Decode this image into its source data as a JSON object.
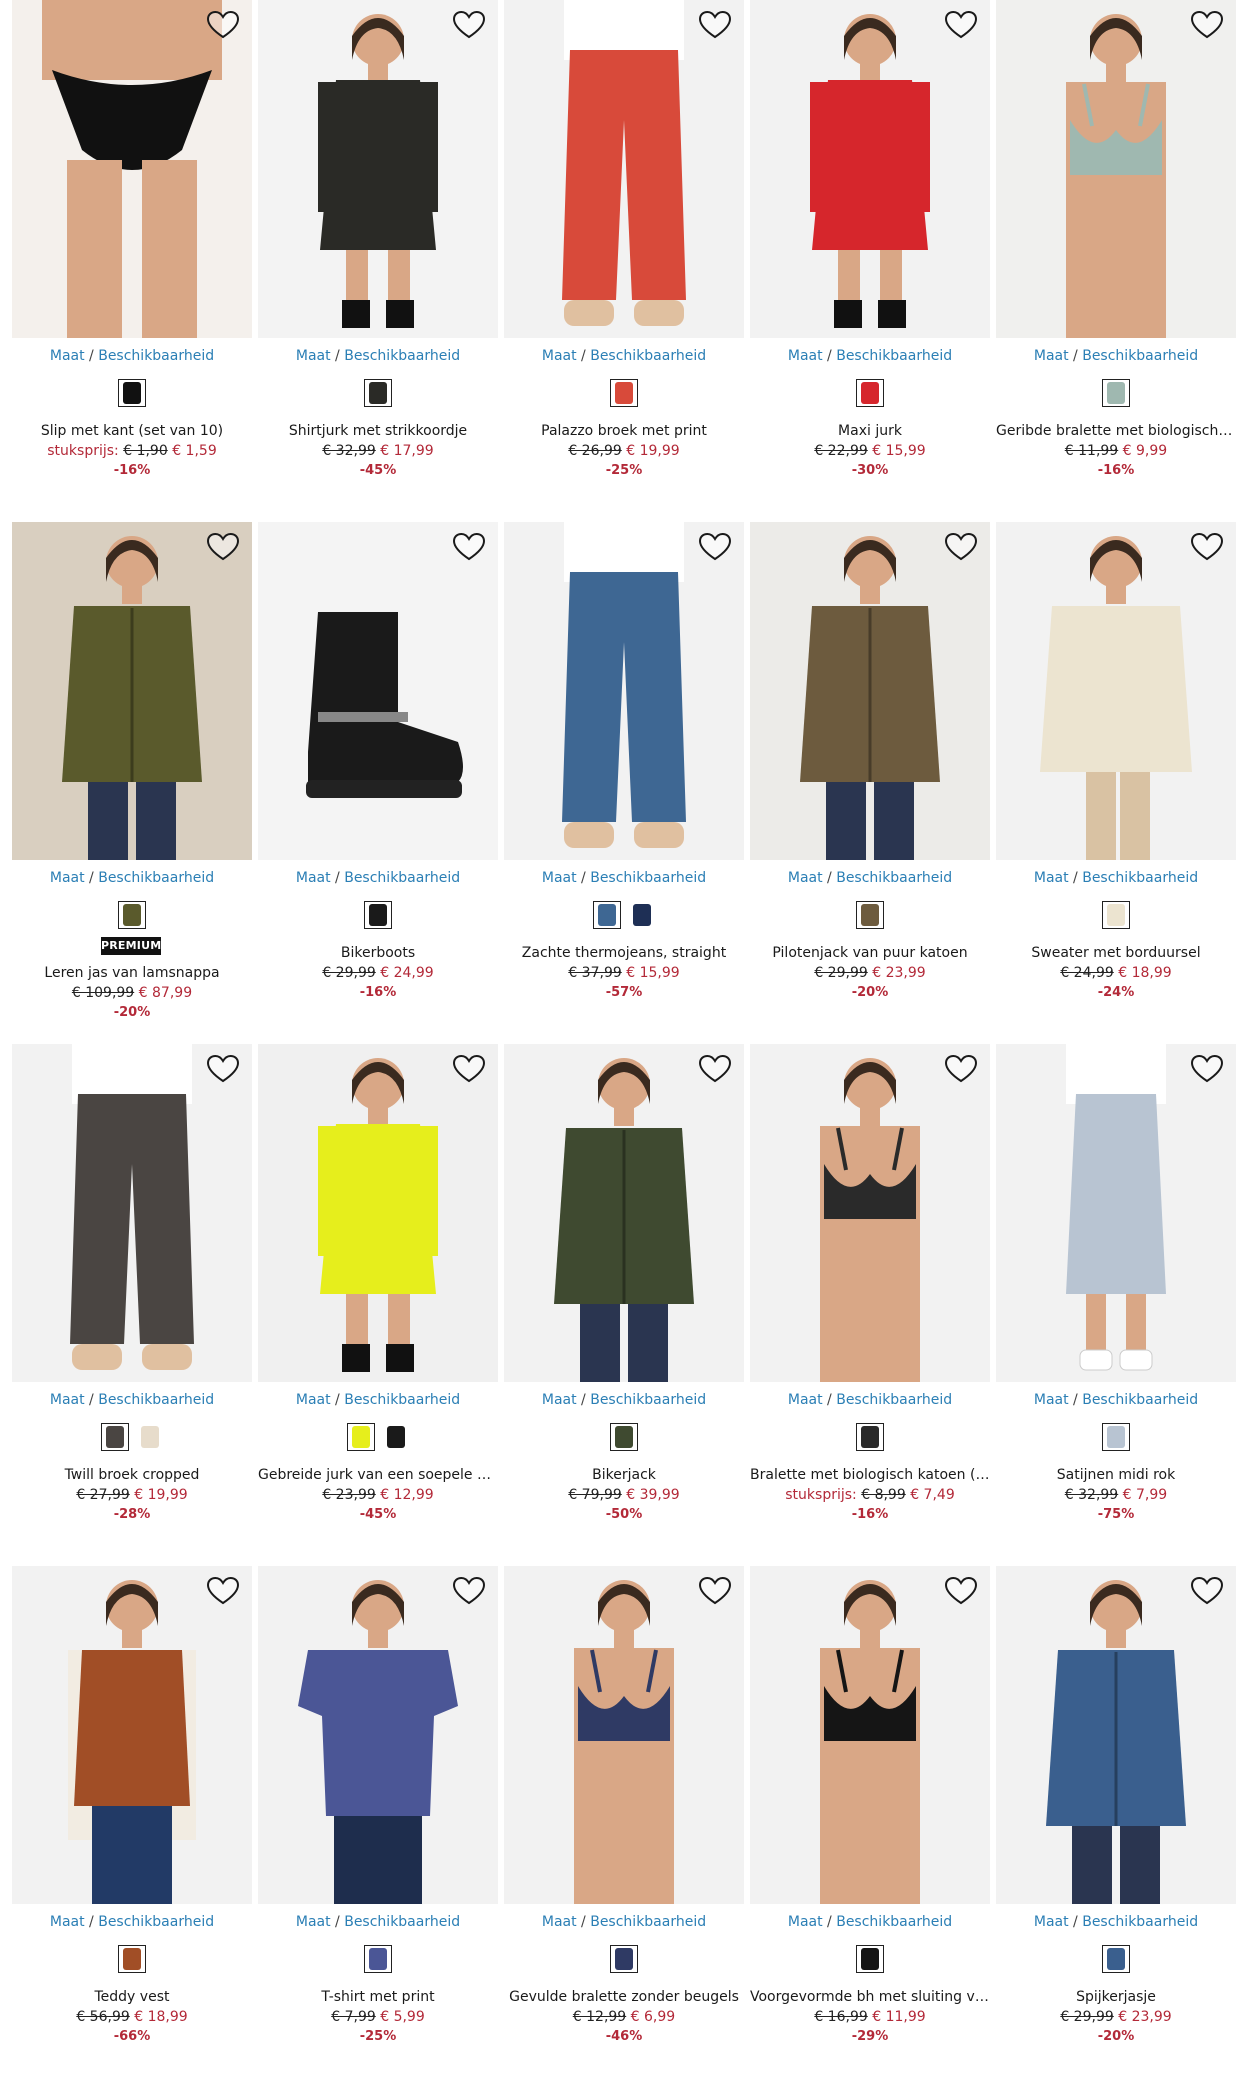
{
  "labels": {
    "size_link": "Maat",
    "separator": "/",
    "availability_link": "Beschikbaarheid"
  },
  "colors": {
    "accent_link": "#2b7fb5",
    "sale_price": "#b32938",
    "text": "#1a1a1a"
  },
  "products": [
    {
      "name": "Slip met kant (set van 10)",
      "unit_label": "stuksprijs:",
      "old_price": "€ 1,90",
      "new_price": "€ 1,59",
      "discount": "-16%",
      "swatches": [
        "#111111"
      ],
      "bg": "#f4f0ec"
    },
    {
      "name": "Shirtjurk met strikkoordje",
      "old_price": "€ 32,99",
      "new_price": "€ 17,99",
      "discount": "-45%",
      "swatches": [
        "#2a2a26"
      ],
      "bg": "#f3f3f3"
    },
    {
      "name": "Palazzo broek met print",
      "old_price": "€ 26,99",
      "new_price": "€ 19,99",
      "discount": "-25%",
      "swatches": [
        "#d84a3a"
      ],
      "bg": "#f2f2f2"
    },
    {
      "name": "Maxi jurk",
      "old_price": "€ 22,99",
      "new_price": "€ 15,99",
      "discount": "-30%",
      "swatches": [
        "#d6262c"
      ],
      "bg": "#f2f2f2"
    },
    {
      "name": "Geribde bralette met biologisch ka...",
      "old_price": "€ 11,99",
      "new_price": "€ 9,99",
      "discount": "-16%",
      "swatches": [
        "#9fb8b0"
      ],
      "bg": "#f0f0ee"
    },
    {
      "name": "Leren jas van lamsnappa",
      "badge": "PREMIUM",
      "old_price": "€ 109,99",
      "new_price": "€ 87,99",
      "discount": "-20%",
      "swatches": [
        "#5a5a2c"
      ],
      "bg": "#d9cfc0"
    },
    {
      "name": "Bikerboots",
      "old_price": "€ 29,99",
      "new_price": "€ 24,99",
      "discount": "-16%",
      "swatches": [
        "#1a1a1a"
      ],
      "bg": "#f4f4f4"
    },
    {
      "name": "Zachte thermojeans, straight",
      "old_price": "€ 37,99",
      "new_price": "€ 15,99",
      "discount": "-57%",
      "swatches": [
        "#3e6793",
        "#1e2f55"
      ],
      "bg": "#f2f2f2"
    },
    {
      "name": "Pilotenjack van puur katoen",
      "old_price": "€ 29,99",
      "new_price": "€ 23,99",
      "discount": "-20%",
      "swatches": [
        "#6d5b3e"
      ],
      "bg": "#ecebe8"
    },
    {
      "name": "Sweater met borduursel",
      "old_price": "€ 24,99",
      "new_price": "€ 18,99",
      "discount": "-24%",
      "swatches": [
        "#ece4d0"
      ],
      "bg": "#f2f2f2"
    },
    {
      "name": "Twill broek cropped",
      "old_price": "€ 27,99",
      "new_price": "€ 19,99",
      "discount": "-28%",
      "swatches": [
        "#4a4542",
        "#e7dccb"
      ],
      "bg": "#f2f2f2"
    },
    {
      "name": "Gebreide jurk van een soepele visc...",
      "old_price": "€ 23,99",
      "new_price": "€ 12,99",
      "discount": "-45%",
      "swatches": [
        "#e6ee1c",
        "#1a1a1a"
      ],
      "bg": "#f0f0f0"
    },
    {
      "name": "Bikerjack",
      "old_price": "€ 79,99",
      "new_price": "€ 39,99",
      "discount": "-50%",
      "swatches": [
        "#3f4a30"
      ],
      "bg": "#f2f2f2"
    },
    {
      "name": "Bralette met biologisch katoen (set...",
      "unit_label": "stuksprijs:",
      "old_price": "€ 8,99",
      "new_price": "€ 7,49",
      "discount": "-16%",
      "swatches": [
        "#2a2a2a"
      ],
      "bg": "#f2f2f2"
    },
    {
      "name": "Satijnen midi rok",
      "old_price": "€ 32,99",
      "new_price": "€ 7,99",
      "discount": "-75%",
      "swatches": [
        "#b8c4d2"
      ],
      "bg": "#f2f2f2"
    },
    {
      "name": "Teddy vest",
      "old_price": "€ 56,99",
      "new_price": "€ 18,99",
      "discount": "-66%",
      "swatches": [
        "#a14e26"
      ],
      "bg": "#f2f2f2"
    },
    {
      "name": "T-shirt met print",
      "old_price": "€ 7,99",
      "new_price": "€ 5,99",
      "discount": "-25%",
      "swatches": [
        "#4b5696"
      ],
      "bg": "#f2f2f2"
    },
    {
      "name": "Gevulde bralette zonder beugels",
      "old_price": "€ 12,99",
      "new_price": "€ 6,99",
      "discount": "-46%",
      "swatches": [
        "#2f3a64"
      ],
      "bg": "#f2f2f2"
    },
    {
      "name": "Voorgevormde bh met sluiting voor...",
      "old_price": "€ 16,99",
      "new_price": "€ 11,99",
      "discount": "-29%",
      "swatches": [
        "#151515"
      ],
      "bg": "#f2f2f2"
    },
    {
      "name": "Spijkerjasje",
      "old_price": "€ 29,99",
      "new_price": "€ 23,99",
      "discount": "-20%",
      "swatches": [
        "#3a5f8e"
      ],
      "bg": "#f2f2f2"
    }
  ]
}
